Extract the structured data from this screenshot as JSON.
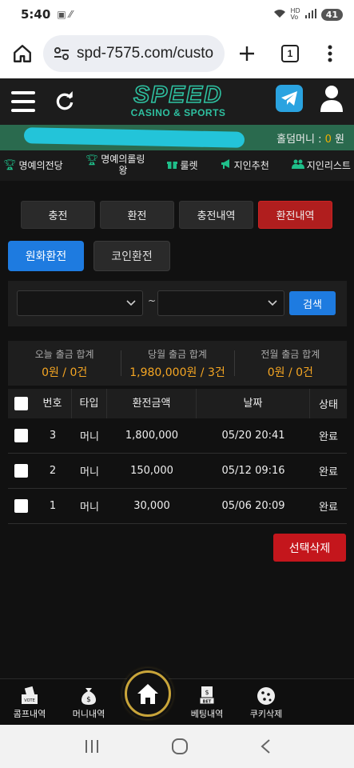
{
  "status_bar": {
    "time": "5:40",
    "battery": "41"
  },
  "browser": {
    "url": "spd-7575.com/custo",
    "tab_count": "1"
  },
  "header": {
    "logo_main": "SPEED",
    "logo_sub": "CASINO & SPORTS"
  },
  "info_strip": {
    "holdem_label": "홀덤머니 :",
    "holdem_value": "0",
    "holdem_unit": "원"
  },
  "quick_nav": [
    {
      "label": "명예의전당",
      "icon": "trophy-icon"
    },
    {
      "label_line1": "명예의롤링",
      "label_line2": "왕",
      "icon": "trophy-icon"
    },
    {
      "label": "룰렛",
      "icon": "gift-icon"
    },
    {
      "label": "지인추천",
      "icon": "megaphone-icon"
    },
    {
      "label": "지인리스트",
      "icon": "users-icon"
    }
  ],
  "tabs": [
    {
      "label": "충전",
      "active": false
    },
    {
      "label": "환전",
      "active": false
    },
    {
      "label": "충전내역",
      "active": false
    },
    {
      "label": "환전내역",
      "active": true
    }
  ],
  "sub_tabs": [
    {
      "label": "원화환전",
      "active": true
    },
    {
      "label": "코인환전",
      "active": false
    }
  ],
  "filter": {
    "tilde": "~",
    "search_label": "검색"
  },
  "summary": [
    {
      "label": "오늘 출금 합계",
      "value": "0원 / 0건"
    },
    {
      "label": "당월 출금 합계",
      "value": "1,980,000원 / 3건"
    },
    {
      "label": "전월 출금 합계",
      "value": "0원 / 0건"
    }
  ],
  "table": {
    "headers": {
      "no": "번호",
      "type": "타입",
      "amount": "환전금액",
      "date": "날짜",
      "status": "상태"
    },
    "rows": [
      {
        "no": "3",
        "type": "머니",
        "amount": "1,800,000",
        "date": "05/20 20:41",
        "status": "완료"
      },
      {
        "no": "2",
        "type": "머니",
        "amount": "150,000",
        "date": "05/12 09:16",
        "status": "완료"
      },
      {
        "no": "1",
        "type": "머니",
        "amount": "30,000",
        "date": "05/06 20:09",
        "status": "완료"
      }
    ]
  },
  "delete_label": "선택삭제",
  "bottom_nav": [
    {
      "label": "콤프내역",
      "icon": "vote-box-icon"
    },
    {
      "label": "머니내역",
      "icon": "money-bag-icon"
    },
    {
      "label": "",
      "icon": "home-icon"
    },
    {
      "label": "베팅내역",
      "icon": "bet-icon"
    },
    {
      "label": "쿠키삭제",
      "icon": "cookie-icon"
    }
  ],
  "colors": {
    "accent_red": "#c4161c",
    "accent_blue": "#1e7be0",
    "brand_teal": "#2ec0a0",
    "value_orange": "#f5a623"
  }
}
